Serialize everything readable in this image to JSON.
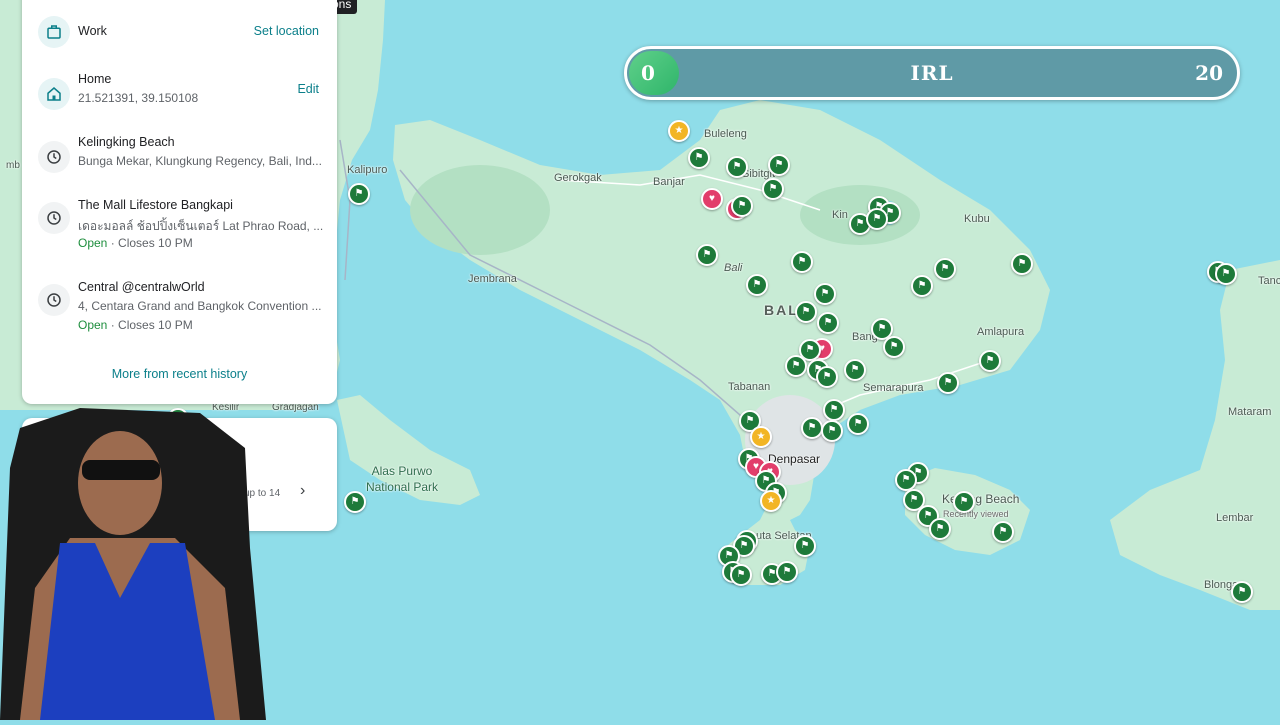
{
  "tooltip": "Directions",
  "recent": {
    "items": [
      {
        "title": "Work",
        "action": "Set location",
        "icon": "briefcase-icon"
      },
      {
        "title": "Home",
        "subtitle": "21.521391, 39.150108",
        "action": "Edit",
        "icon": "home-icon"
      },
      {
        "title": "Kelingking Beach",
        "subtitle": "Bunga Mekar, Klungkung Regency, Bali, Ind...",
        "icon": "history-icon"
      },
      {
        "title": "The Mall Lifestore Bangkapi",
        "subtitle": "เดอะมอลล์ ช้อปปิ้งเซ็นเตอร์ Lat Phrao Road, ...",
        "status": "Open",
        "hours": "· Closes 10 PM",
        "icon": "history-icon"
      },
      {
        "title": "Central @centralwOrld",
        "subtitle": "4, Centara Grand and Bangkok Convention ...",
        "status": "Open",
        "hours": "· Closes 10 PM",
        "icon": "history-icon"
      }
    ],
    "more_label": "More from recent history"
  },
  "card2": {
    "text": "up to 14"
  },
  "score": {
    "left": "0",
    "title": "IRL",
    "right": "20",
    "progress": 0
  },
  "map": {
    "labels": {
      "buleleng": "Buleleng",
      "gerokgak": "Gerokgak",
      "banjar": "Banjar",
      "sibitgit": "Sibitgit",
      "kintamani": "Kin",
      "kubu": "Kubu",
      "kalipuro": "Kalipuro",
      "jembrana": "Jembrana",
      "bali_italic": "Bali",
      "bali": "BALI",
      "bangli": "Bang",
      "amlapura": "Amlapura",
      "semarapura": "Semarapura",
      "tabanan": "Tabanan",
      "denpasar": "Denpasar",
      "kuta_selatan": "uta Selatan",
      "alas_purwo": "Alas Purwo National Park",
      "kelingking": "Ke  king Beach",
      "recently_viewed": "Recently viewed",
      "mataram": "Mataram",
      "lembar": "Lembar",
      "blonga": "Blonga",
      "tanc": "Tanc",
      "kesilir": "Kesilir",
      "gradjagan": "Gradjagan",
      "mb": "mb"
    },
    "colors": {
      "water": "#8fdde9",
      "land": "#c8ebd5",
      "flag_marker": "#1e7a3a",
      "heart_marker": "#e23d6b",
      "star_marker": "#f2b524"
    }
  }
}
